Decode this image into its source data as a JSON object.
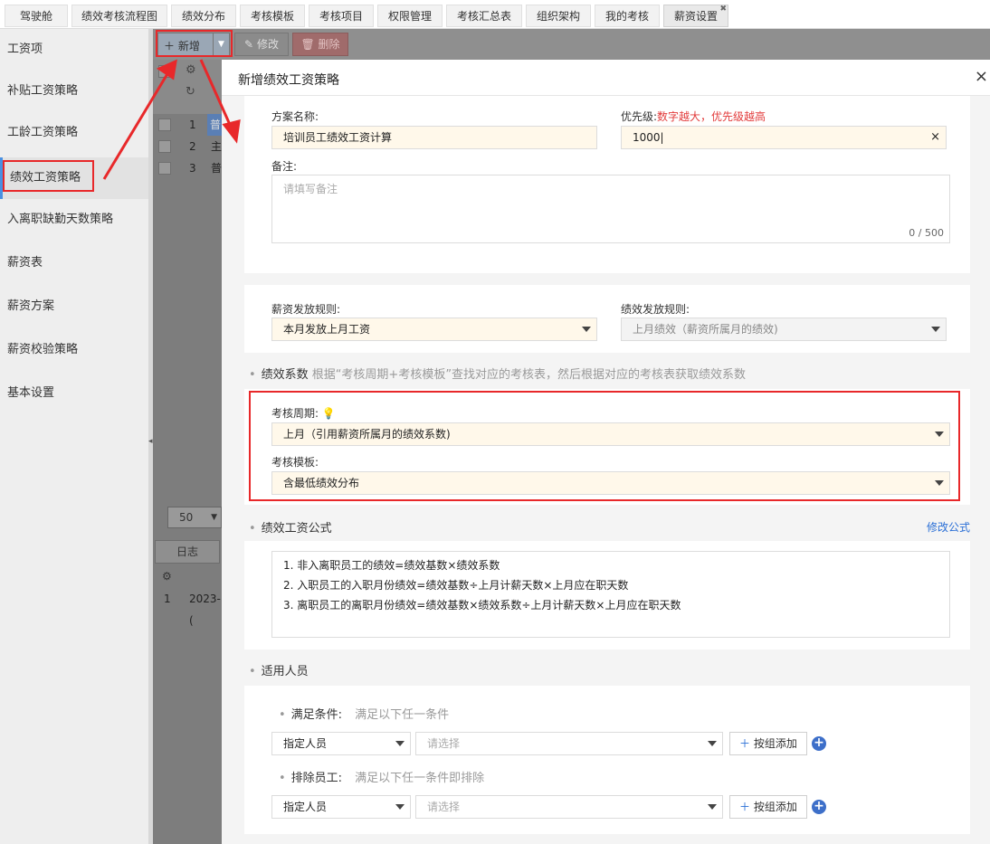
{
  "top_tabs": [
    {
      "label": "驾驶舱"
    },
    {
      "label": "绩效考核流程图"
    },
    {
      "label": "绩效分布"
    },
    {
      "label": "考核模板"
    },
    {
      "label": "考核项目"
    },
    {
      "label": "权限管理"
    },
    {
      "label": "考核汇总表"
    },
    {
      "label": "组织架构"
    },
    {
      "label": "我的考核"
    },
    {
      "label": "薪资设置",
      "active": true
    }
  ],
  "sidebar": {
    "items": [
      {
        "label": "工资项"
      },
      {
        "label": "补贴工资策略"
      },
      {
        "label": "工龄工资策略"
      },
      {
        "label": "绩效工资策略",
        "active": true
      },
      {
        "label": "入离职缺勤天数策略"
      },
      {
        "label": "薪资表"
      },
      {
        "label": "薪资方案"
      },
      {
        "label": "薪资校验策略"
      },
      {
        "label": "基本设置"
      }
    ]
  },
  "toolbar": {
    "new_label": "新增",
    "edit_label": "修改",
    "delete_label": "删除"
  },
  "background_grid": {
    "rows": [
      {
        "no": "1",
        "text": "普"
      },
      {
        "no": "2",
        "text": "主"
      },
      {
        "no": "3",
        "text": "普"
      }
    ],
    "page_size": "50",
    "log_tab": "日志",
    "log_row": {
      "no": "1",
      "text": "2023-("
    }
  },
  "dialog": {
    "title": "新增绩效工资策略",
    "close": "×",
    "plan_name_label": "方案名称:",
    "plan_name_value": "培训员工绩效工资计算",
    "priority_label": "优先级:",
    "priority_hint": "数字越大，优先级越高",
    "priority_value": "1000",
    "remark_label": "备注:",
    "remark_placeholder": "请填写备注",
    "remark_counter": "0 / 500",
    "salary_rule_label": "薪资发放规则:",
    "salary_rule_value": "本月发放上月工资",
    "perf_rule_label": "绩效发放规则:",
    "perf_rule_value": "上月绩效（薪资所属月的绩效)",
    "coef_section_title": "绩效系数",
    "coef_section_desc": "根据“考核周期+考核模板”查找对应的考核表，然后根据对应的考核表获取绩效系数",
    "period_label": "考核周期:",
    "period_value": "上月（引用薪资所属月的绩效系数)",
    "template_label": "考核模板:",
    "template_value": "含最低绩效分布",
    "formula_section_title": "绩效工资公式",
    "edit_formula_link": "修改公式",
    "formula_lines": [
      "1. 非入离职员工的绩效=绩效基数×绩效系数",
      "2. 入职员工的入职月份绩效=绩效基数÷上月计薪天数×上月应在职天数",
      "3. 离职员工的离职月份绩效=绩效基数×绩效系数÷上月计薪天数×上月应在职天数"
    ],
    "applicable_section_title": "适用人员",
    "include_label": "满足条件:",
    "include_desc": "满足以下任一条件",
    "include_select": "指定人员",
    "include_placeholder": "请选择",
    "add_group_label": "按组添加",
    "exclude_label": "排除员工:",
    "exclude_desc": "满足以下任一条件即排除",
    "exclude_select": "指定人员",
    "exclude_placeholder": "请选择"
  },
  "colors": {
    "accent": "#4a90e2",
    "annotation": "#e8282a",
    "input_bg": "#fff8ea",
    "link": "#2a6fd6",
    "hint": "#e23b3b"
  }
}
